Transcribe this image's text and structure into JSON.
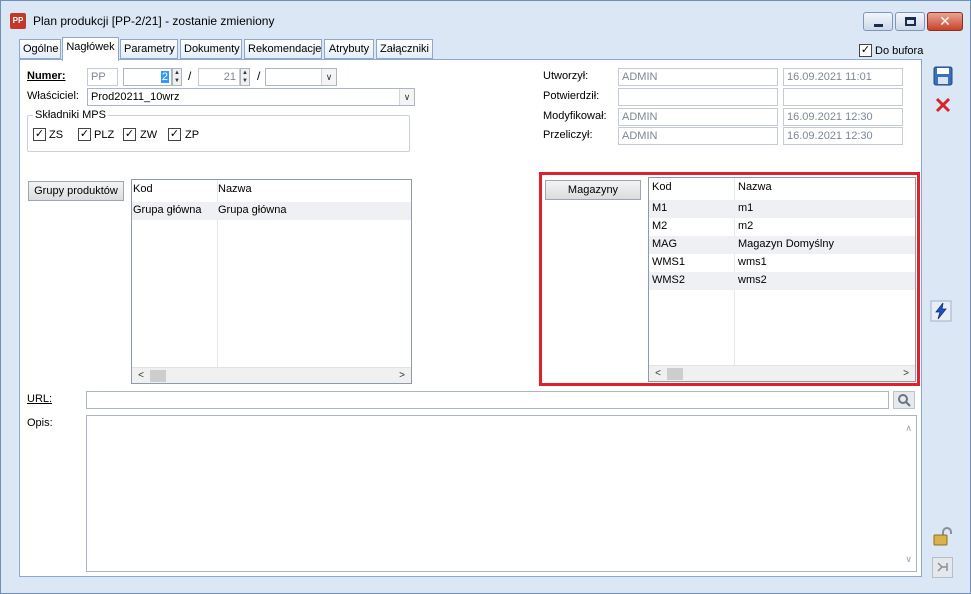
{
  "window": {
    "title": "Plan produkcji [PP-2/21] - zostanie zmieniony",
    "app_icon_text": "PP"
  },
  "tabs": [
    "Ogólne",
    "Nagłówek",
    "Parametry",
    "Dokumenty",
    "Rekomendacje",
    "Atrybuty",
    "Załączniki"
  ],
  "active_tab": "Nagłówek",
  "do_bufora": {
    "label": "Do bufora",
    "checked": true,
    "mark": "✓"
  },
  "numer": {
    "label": "Numer:",
    "prefix": "PP",
    "number": "2",
    "separator1": "/",
    "year": "21",
    "separator2": "/",
    "series": ""
  },
  "wlasciciel": {
    "label": "Właściciel:",
    "value": "Prod20211_10wrz"
  },
  "skladniki": {
    "title": "Składniki MPS",
    "items": [
      {
        "label": "ZS",
        "checked": true
      },
      {
        "label": "PLZ",
        "checked": true
      },
      {
        "label": "ZW",
        "checked": true
      },
      {
        "label": "ZP",
        "checked": true
      }
    ],
    "mark": "✓"
  },
  "audit": {
    "utworzyl": {
      "label": "Utworzył:",
      "user": "ADMIN",
      "date": "16.09.2021 11:01"
    },
    "potwierdzil": {
      "label": "Potwierdził:",
      "user": "",
      "date": ""
    },
    "modyfikowal": {
      "label": "Modyfikował:",
      "user": "ADMIN",
      "date": "16.09.2021 12:30"
    },
    "przeliczyl": {
      "label": "Przeliczył:",
      "user": "ADMIN",
      "date": "16.09.2021 12:30"
    }
  },
  "grupy": {
    "button": "Grupy produktów",
    "columns": [
      "Kod",
      "Nazwa"
    ],
    "rows": [
      {
        "kod": "Grupa główna",
        "nazwa": "Grupa główna"
      }
    ]
  },
  "magazyny": {
    "button": "Magazyny",
    "columns": [
      "Kod",
      "Nazwa"
    ],
    "rows": [
      {
        "kod": "M1",
        "nazwa": "m1"
      },
      {
        "kod": "M2",
        "nazwa": "m2"
      },
      {
        "kod": "MAG",
        "nazwa": "Magazyn Domyślny"
      },
      {
        "kod": "WMS1",
        "nazwa": "wms1"
      },
      {
        "kod": "WMS2",
        "nazwa": "wms2"
      }
    ]
  },
  "url": {
    "label": "URL:",
    "value": ""
  },
  "opis": {
    "label": "Opis:",
    "value": ""
  },
  "glyphs": {
    "spin_up": "▲",
    "spin_down": "▼",
    "dropdown": "∨",
    "scroll_left": "<",
    "scroll_right": ">",
    "scroll_up": "∧",
    "scroll_down": "∨",
    "close": "✕"
  },
  "colors": {
    "highlight": "#e0202a",
    "accent": "#3399ff"
  }
}
